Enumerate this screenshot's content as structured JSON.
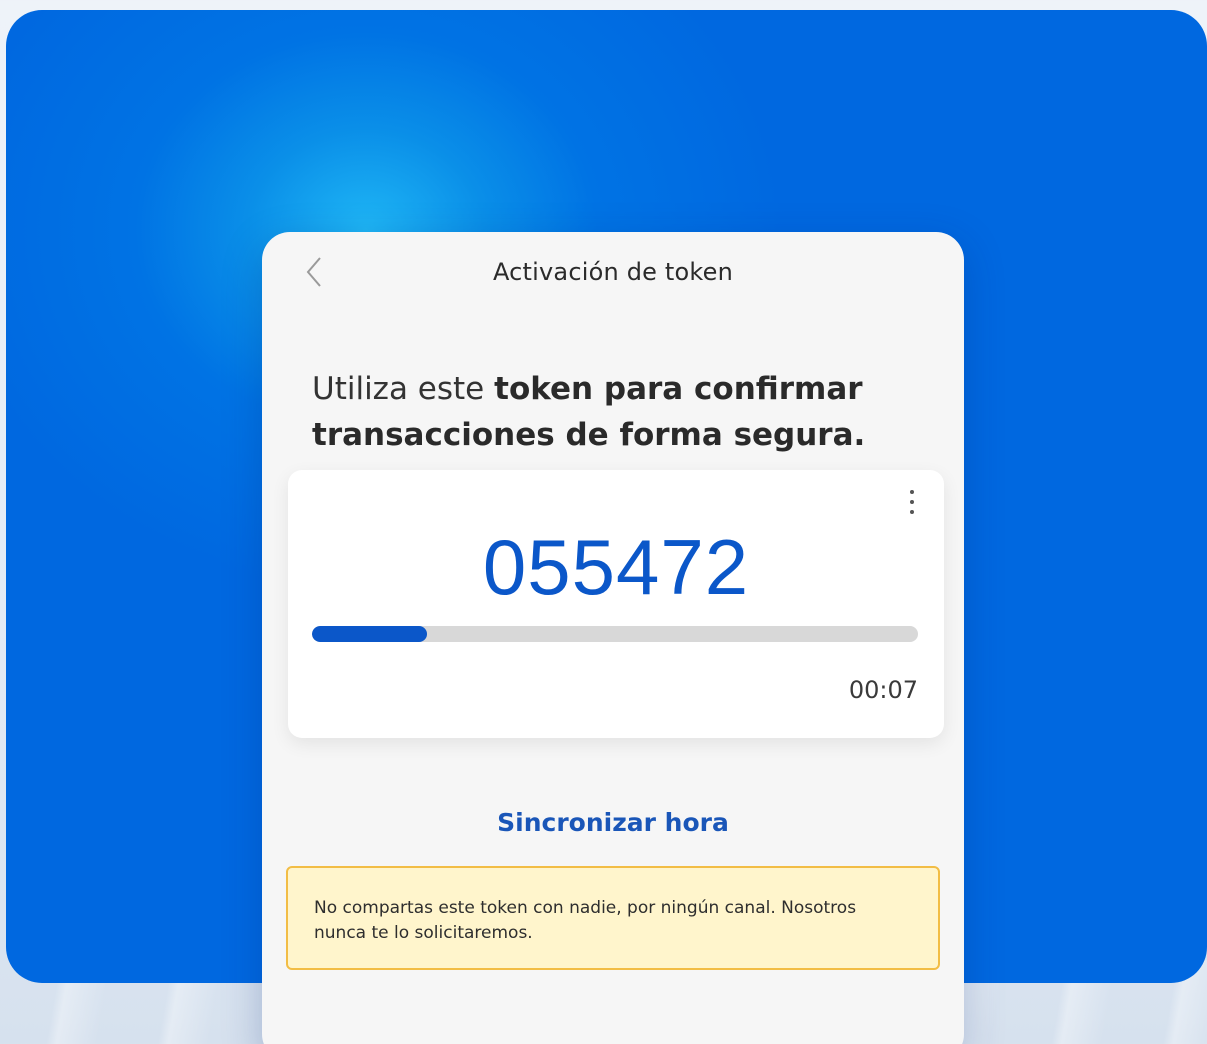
{
  "screen": {
    "title": "Activación de token"
  },
  "headline": {
    "part1": "Utiliza este ",
    "part2": "token para confirmar transacciones de forma segura."
  },
  "token_card": {
    "code": "055472",
    "progress_fraction": 0.19,
    "timer": "00:07",
    "menu_icon": "kebab-menu-icon"
  },
  "sync": {
    "label": "Sincronizar hora"
  },
  "warning": {
    "text": "No compartas este token con nadie, por ningún canal. Nosotros nunca te lo solicitaremos."
  },
  "colors": {
    "brand_blue": "#0068e0",
    "token_blue": "#0b57c9",
    "warning_bg": "#fff5cc",
    "warning_border": "#f2bd45"
  }
}
